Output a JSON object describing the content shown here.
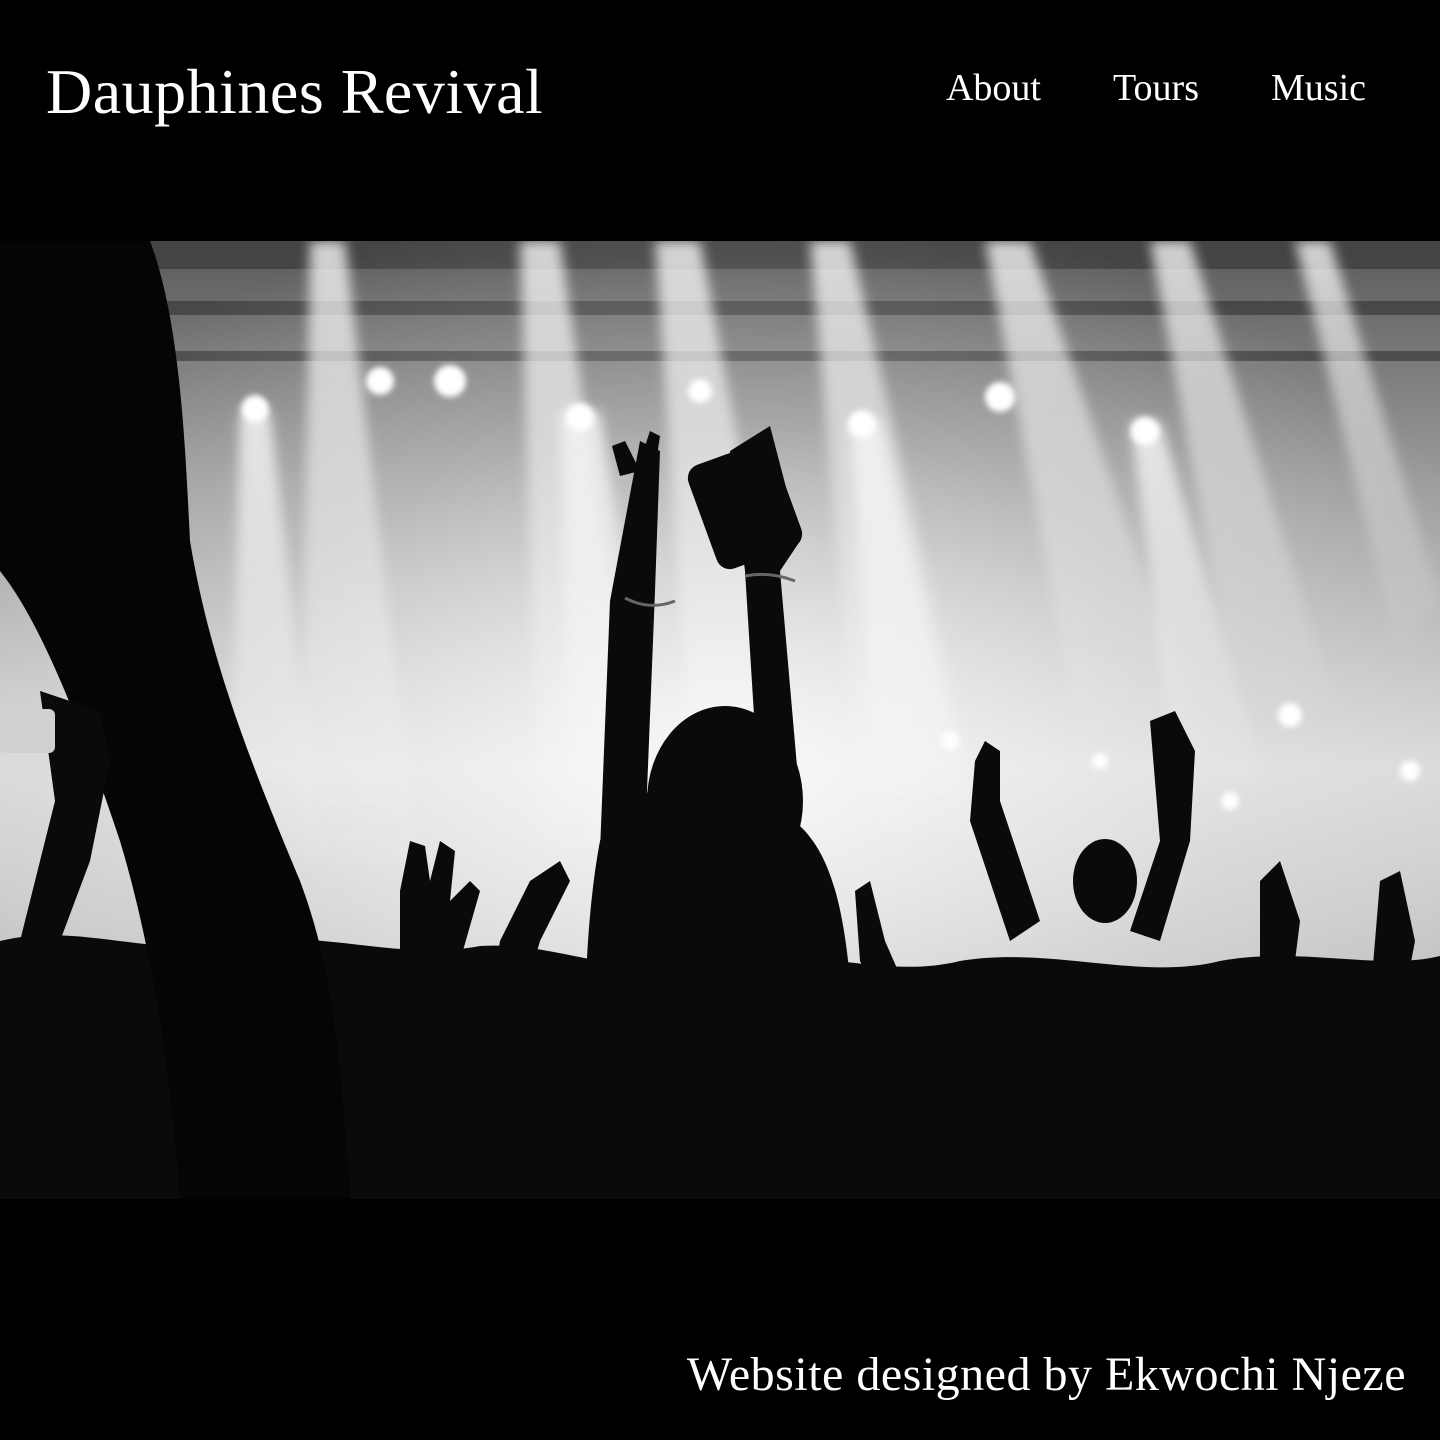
{
  "header": {
    "site_title": "Dauphines Revival",
    "nav": [
      {
        "label": "About"
      },
      {
        "label": "Tours"
      },
      {
        "label": "Music"
      }
    ]
  },
  "hero": {
    "image_subject": "black-and-white concert crowd photo with raised hands and stage lights"
  },
  "footer": {
    "credit": "Website designed by Ekwochi Njeze"
  },
  "colors": {
    "background": "#000000",
    "text": "#ffffff"
  }
}
